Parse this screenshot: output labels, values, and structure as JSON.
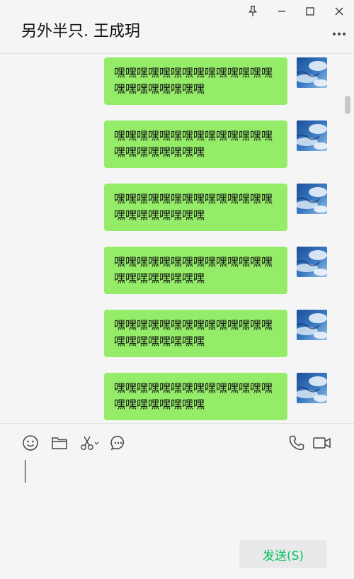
{
  "header": {
    "title": "另外半只. 王成玥",
    "pin_icon": "pin-icon",
    "minimize_icon": "minimize-icon",
    "maximize_icon": "maximize-icon",
    "close_icon": "close-icon",
    "more_icon": "more-icon"
  },
  "messages": [
    {
      "text": "嘿嘿嘿嘿嘿嘿嘿嘿嘿嘿嘿嘿嘿嘿嘿嘿嘿嘿嘿嘿嘿嘿",
      "sender": "self"
    },
    {
      "text": "嘿嘿嘿嘿嘿嘿嘿嘿嘿嘿嘿嘿嘿嘿嘿嘿嘿嘿嘿嘿嘿嘿",
      "sender": "self"
    },
    {
      "text": "嘿嘿嘿嘿嘿嘿嘿嘿嘿嘿嘿嘿嘿嘿嘿嘿嘿嘿嘿嘿嘿嘿",
      "sender": "self"
    },
    {
      "text": "嘿嘿嘿嘿嘿嘿嘿嘿嘿嘿嘿嘿嘿嘿嘿嘿嘿嘿嘿嘿嘿嘿",
      "sender": "self"
    },
    {
      "text": "嘿嘿嘿嘿嘿嘿嘿嘿嘿嘿嘿嘿嘿嘿嘿嘿嘿嘿嘿嘿嘿嘿",
      "sender": "self"
    },
    {
      "text": "嘿嘿嘿嘿嘿嘿嘿嘿嘿嘿嘿嘿嘿嘿嘿嘿嘿嘿嘿嘿嘿嘿",
      "sender": "self"
    }
  ],
  "toolbar": {
    "icons": [
      "emoji-icon",
      "folder-icon",
      "scissors-icon",
      "chat-history-icon",
      "phone-icon",
      "video-call-icon"
    ]
  },
  "input": {
    "value": ""
  },
  "send": {
    "label": "发送(S)"
  },
  "colors": {
    "bubble": "#95ec69",
    "accent": "#07c160",
    "background": "#f5f5f5"
  }
}
